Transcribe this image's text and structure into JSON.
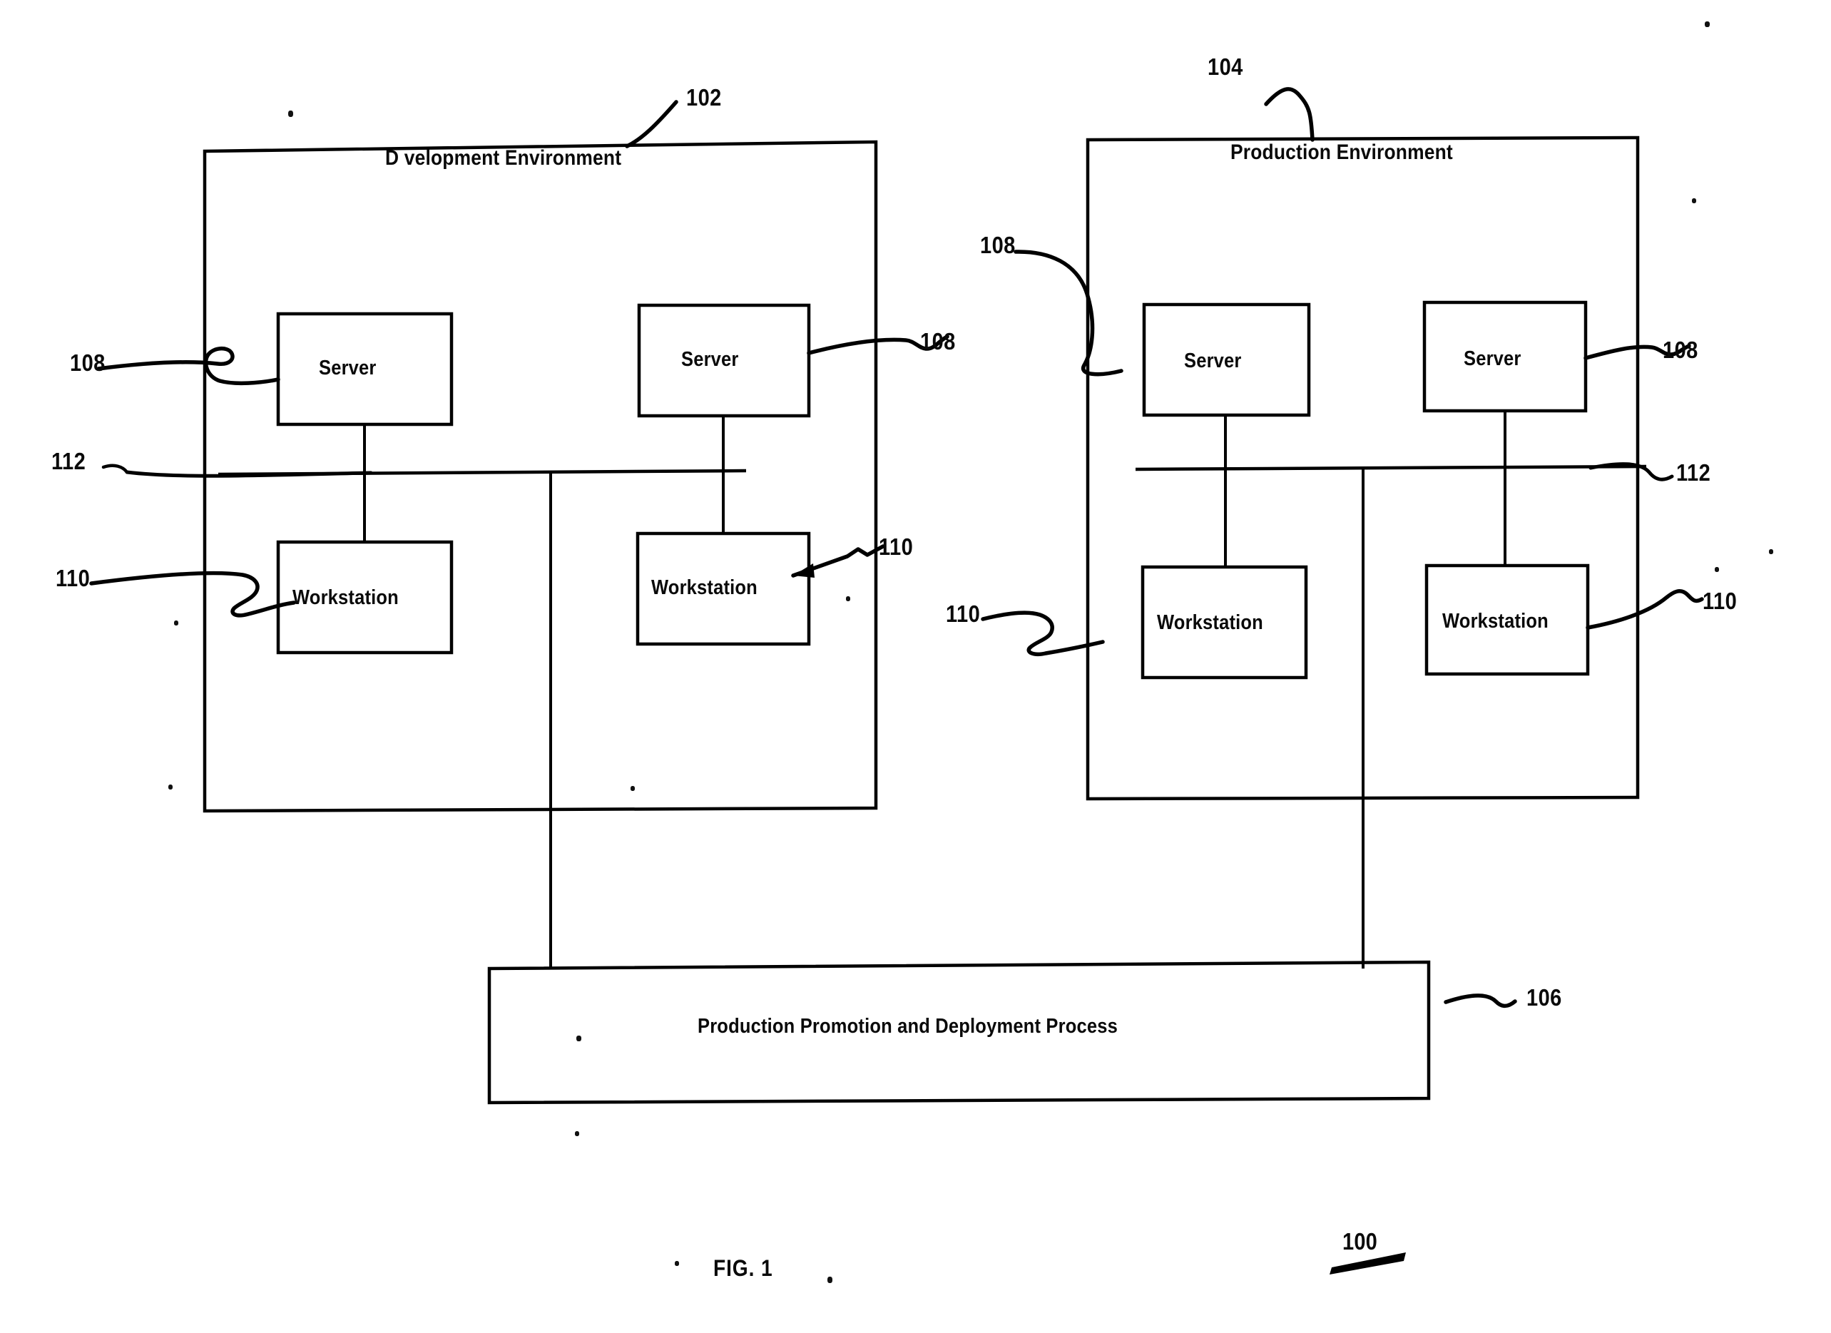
{
  "figure": {
    "caption": "FIG. 1",
    "system_ref": "100"
  },
  "environments": [
    {
      "id": "development",
      "title": "D  velopment Environment",
      "ref": "102",
      "nodes": [
        {
          "type": "server",
          "label": "Server",
          "ref": "108"
        },
        {
          "type": "server",
          "label": "Server",
          "ref": "108"
        },
        {
          "type": "workstation",
          "label": "Workstation",
          "ref": "110"
        },
        {
          "type": "workstation",
          "label": "Workstation",
          "ref": "110"
        }
      ],
      "network": {
        "label": "network-bus",
        "ref": "112"
      }
    },
    {
      "id": "production",
      "title": "Production Environment",
      "ref": "104",
      "nodes": [
        {
          "type": "server",
          "label": "Server",
          "ref": "108"
        },
        {
          "type": "server",
          "label": "Server",
          "ref": "108"
        },
        {
          "type": "workstation",
          "label": "Workstation",
          "ref": "110"
        },
        {
          "type": "workstation",
          "label": "Workstation",
          "ref": "110"
        }
      ],
      "network": {
        "label": "network-bus",
        "ref": "112"
      }
    }
  ],
  "process": {
    "label": "Production Promotion and Deployment Process",
    "ref": "106"
  },
  "reference_numerals": {
    "dev_env": "102",
    "prod_env": "104",
    "process_box": "106",
    "server": "108",
    "workstation": "110",
    "network": "112",
    "system": "100"
  },
  "style": {
    "ink": "#000000",
    "paper": "#ffffff"
  }
}
